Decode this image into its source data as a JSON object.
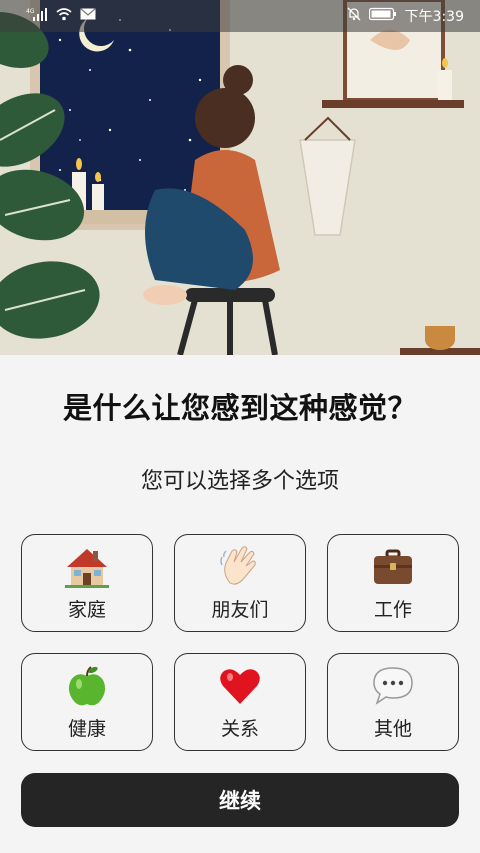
{
  "status_bar": {
    "time": "下午3:39",
    "network_label": "4G",
    "icons": [
      "signal-icon",
      "wifi-icon",
      "mail-icon",
      "mute-bell-icon",
      "battery-icon"
    ]
  },
  "hero": {
    "description_icon": "illustration-woman-window"
  },
  "main": {
    "question": "是什么让您感到这种感觉？",
    "hint": "您可以选择多个选项",
    "options": [
      {
        "label": "家庭",
        "icon": "house-icon"
      },
      {
        "label": "朋友们",
        "icon": "waving-hand-icon"
      },
      {
        "label": "工作",
        "icon": "briefcase-icon"
      },
      {
        "label": "健康",
        "icon": "green-apple-icon"
      },
      {
        "label": "关系",
        "icon": "heart-icon"
      },
      {
        "label": "其他",
        "icon": "speech-bubble-icon"
      }
    ],
    "continue_label": "继续"
  },
  "colors": {
    "button_bg": "#252525",
    "background": "#f4f4f4",
    "border": "#333333"
  }
}
